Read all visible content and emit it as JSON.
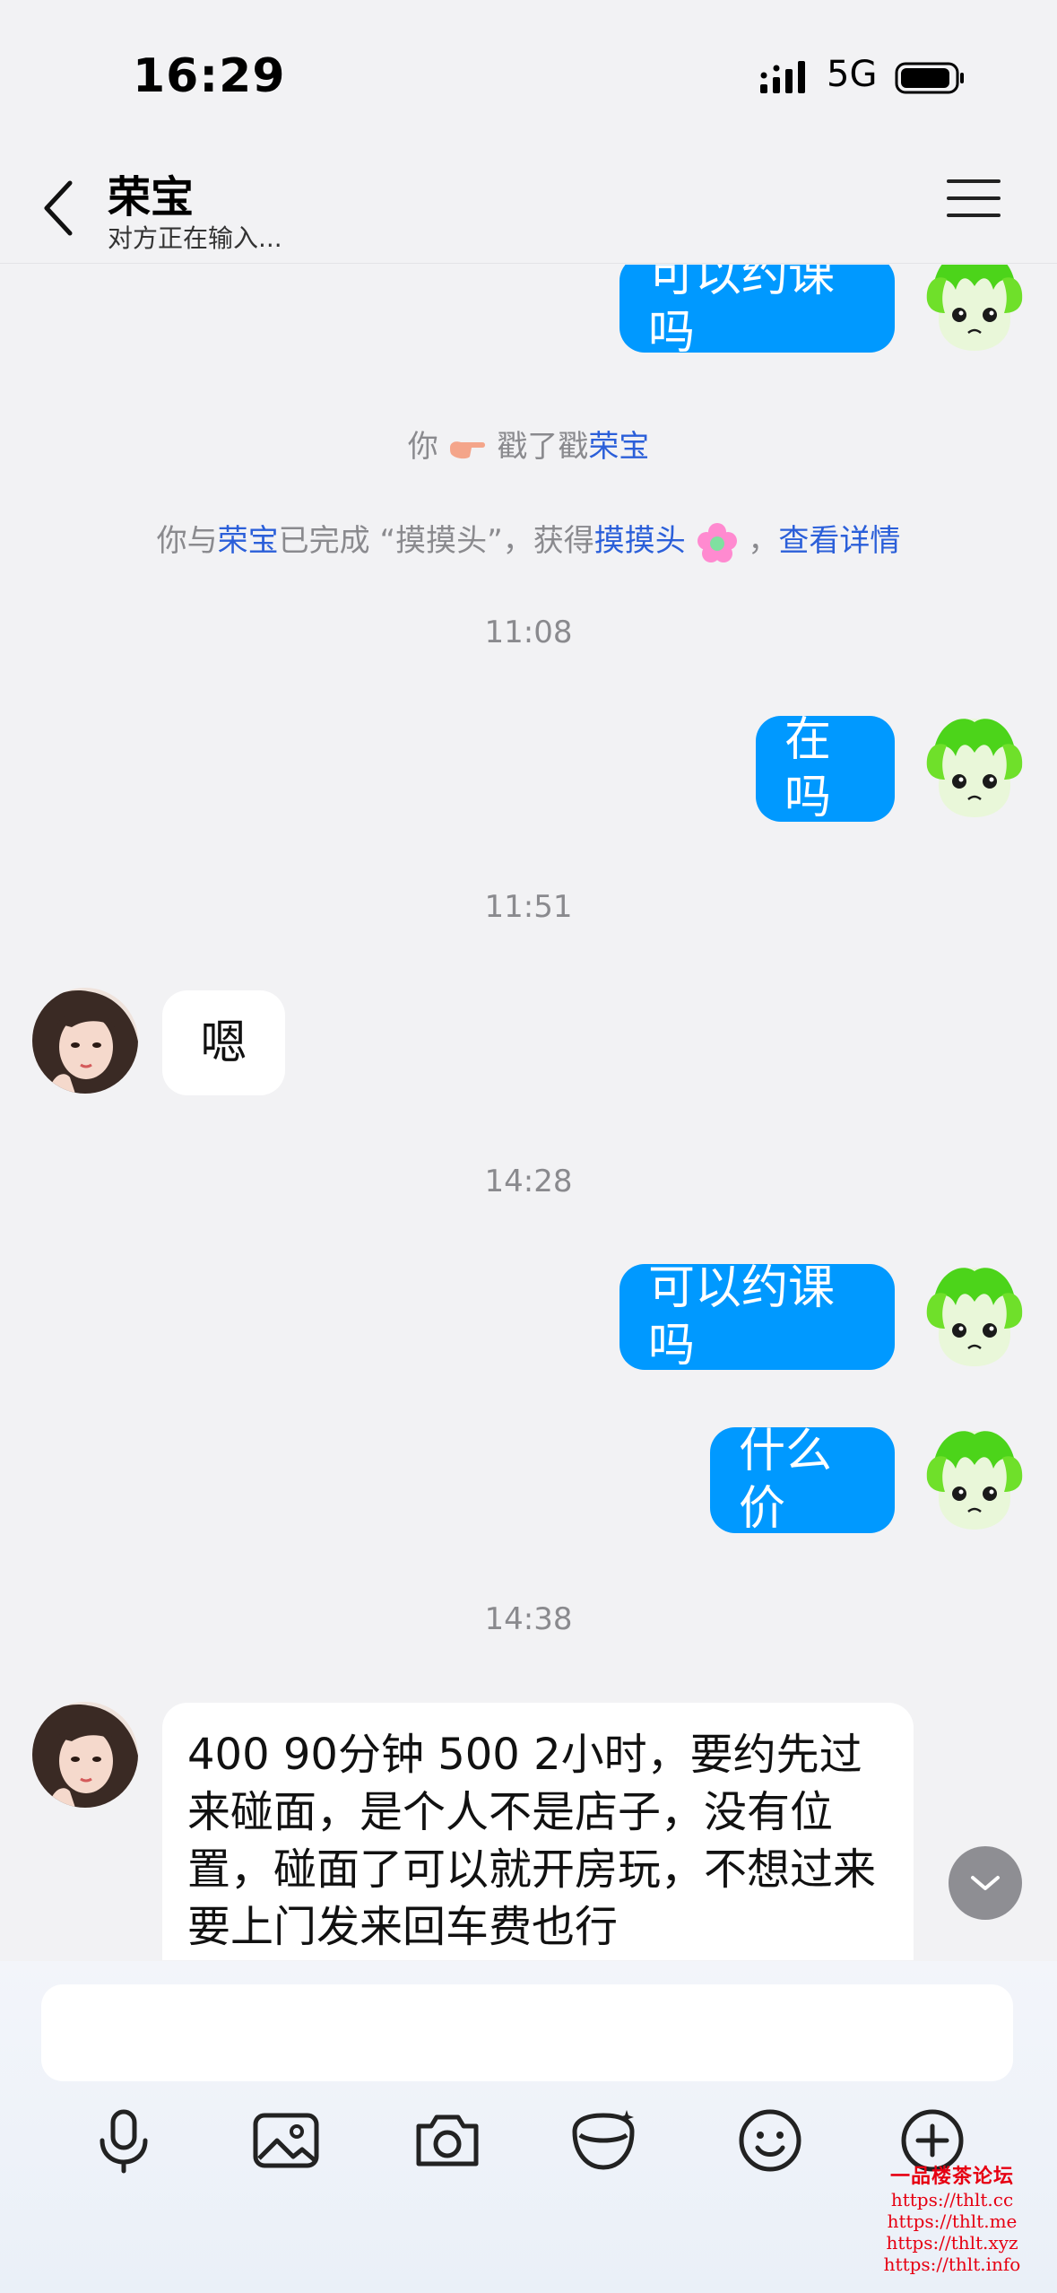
{
  "status_bar": {
    "time": "16:29",
    "network": "5G"
  },
  "header": {
    "contact_name": "荣宝",
    "typing_status": "对方正在输入..."
  },
  "chat": {
    "messages": [
      {
        "side": "out",
        "text": "可以约课吗"
      },
      {
        "side": "out",
        "text": "在吗"
      },
      {
        "side": "in",
        "text": "嗯"
      },
      {
        "side": "out",
        "text": "可以约课吗"
      },
      {
        "side": "out",
        "text": "什么价"
      },
      {
        "side": "in",
        "text": "400 90分钟 500 2小时，要约先过来碰面，是个人不是店子，没有位置，碰面了可以就开房玩，不想过来要上门发来回车费也行"
      }
    ],
    "timestamps": [
      "11:08",
      "11:51",
      "14:28",
      "14:38"
    ],
    "system_poke": {
      "you": "你",
      "action": "戳了戳",
      "target": "荣宝"
    },
    "system_achievement": {
      "prefix": "你与",
      "name": "荣宝",
      "middle": "已完成 “摸摸头”，获得",
      "reward": "摸摸头",
      "separator": "，",
      "details_link": "查看详情"
    }
  },
  "input": {
    "placeholder": "",
    "value": ""
  },
  "toolbar": {
    "icons": [
      "microphone-icon",
      "image-icon",
      "camera-icon",
      "red-packet-icon",
      "emoji-icon",
      "plus-icon"
    ]
  },
  "watermark": {
    "title": "一品楼茶论坛",
    "urls": [
      "https://thlt.cc",
      "https://thlt.me",
      "https://thlt.xyz",
      "https://thlt.info"
    ]
  },
  "colors": {
    "accent_blue": "#0099ff",
    "link_blue": "#2b5fd9",
    "background": "#f2f2f4",
    "watermark_red": "#e60012"
  }
}
